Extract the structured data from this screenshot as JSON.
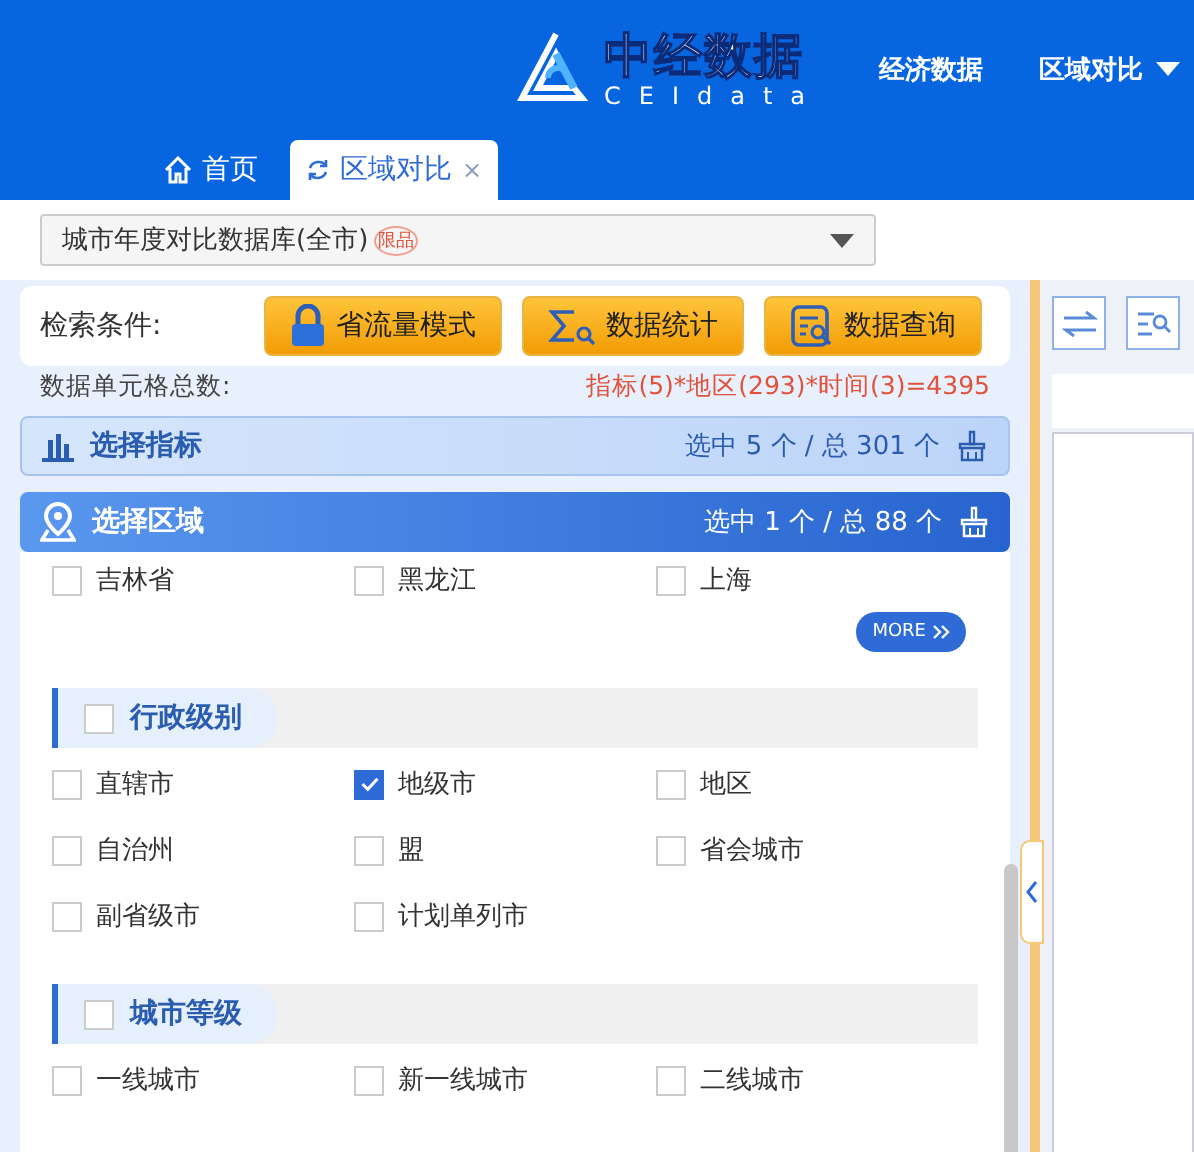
{
  "header": {
    "logo": {
      "name": "中经数据",
      "subtitle": "CEIdata"
    },
    "nav": [
      {
        "label": "经济数据",
        "dropdown": false
      },
      {
        "label": "区域对比",
        "dropdown": true
      }
    ]
  },
  "tabs": [
    {
      "label": "首页",
      "selected": false
    },
    {
      "label": "区域对比",
      "selected": true,
      "close": "×"
    }
  ],
  "database_select": {
    "value": "城市年度对比数据库(全市)",
    "badge": "限品"
  },
  "search": {
    "label": "检索条件:",
    "buttons": [
      {
        "label": "省流量模式"
      },
      {
        "label": "数据统计"
      },
      {
        "label": "数据查询"
      }
    ]
  },
  "cell_count": {
    "label": "数据单元格总数:",
    "formula": "指标(5)*地区(293)*时间(3)=4395"
  },
  "panels": [
    {
      "title": "选择指标",
      "summary": "选中 5 个 / 总 301 个",
      "expanded": false
    },
    {
      "title": "选择区域",
      "summary": "选中 1 个 / 总 88 个",
      "expanded": true
    }
  ],
  "regions": [
    {
      "label": "吉林省",
      "checked": false
    },
    {
      "label": "黑龙江",
      "checked": false
    },
    {
      "label": "上海",
      "checked": false
    }
  ],
  "more": "MORE",
  "groups": [
    {
      "title": "行政级别",
      "checked": false,
      "items": [
        {
          "label": "直辖市",
          "checked": false
        },
        {
          "label": "地级市",
          "checked": true
        },
        {
          "label": "地区",
          "checked": false
        },
        {
          "label": "自治州",
          "checked": false
        },
        {
          "label": "盟",
          "checked": false
        },
        {
          "label": "省会城市",
          "checked": false
        },
        {
          "label": "副省级市",
          "checked": false
        },
        {
          "label": "计划单列市",
          "checked": false
        }
      ]
    },
    {
      "title": "城市等级",
      "checked": false,
      "items": [
        {
          "label": "一线城市",
          "checked": false
        },
        {
          "label": "新一线城市",
          "checked": false
        },
        {
          "label": "二线城市",
          "checked": false
        }
      ]
    }
  ]
}
